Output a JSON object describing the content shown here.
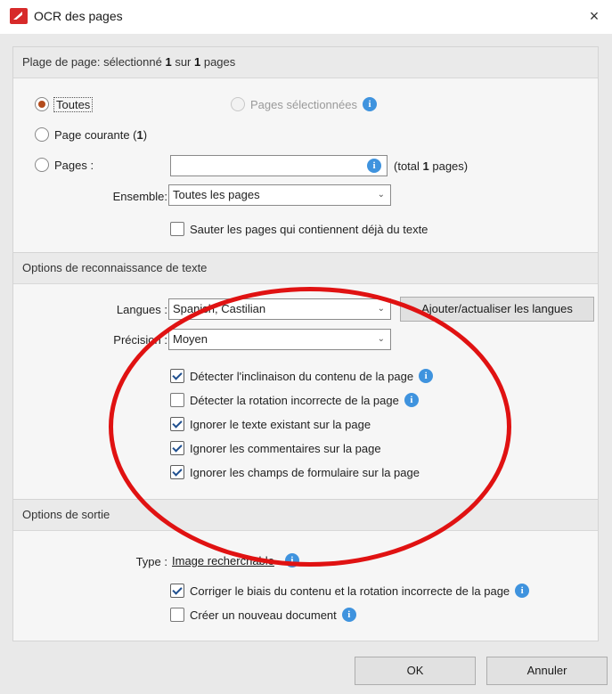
{
  "window": {
    "title": "OCR des pages",
    "close_label": "×"
  },
  "page_range": {
    "header_prefix": "Plage de page: sélectionné ",
    "selected": "1",
    "header_mid": " sur ",
    "total": "1",
    "header_suffix": " pages",
    "all_label": "Toutes",
    "selected_pages_label": "Pages sélectionnées",
    "current_page_label_prefix": "Page courante (",
    "current_page_number": "1",
    "current_page_label_suffix": ")",
    "pages_label": "Pages :",
    "pages_value": "",
    "total_prefix": "(total ",
    "total_number": "1",
    "total_suffix": " pages)",
    "ensemble_label": "Ensemble:",
    "ensemble_value": "Toutes les pages",
    "skip_text_label": "Sauter les pages qui contiennent déjà du texte"
  },
  "recognition": {
    "header": "Options de reconnaissance de texte",
    "languages_label": "Langues :",
    "languages_value": "Spanish; Castilian",
    "add_languages_button": "Ajouter/actualiser les langues",
    "precision_label": "Précision :",
    "precision_value": "Moyen",
    "options": [
      {
        "label": "Détecter l'inclinaison du contenu de la page",
        "checked": true,
        "info": true
      },
      {
        "label": "Détecter la rotation incorrecte de la page",
        "checked": false,
        "info": true
      },
      {
        "label": "Ignorer le texte existant sur la page",
        "checked": true,
        "info": false
      },
      {
        "label": "Ignorer les commentaires sur la page",
        "checked": true,
        "info": false
      },
      {
        "label": "Ignorer les champs de formulaire sur la page",
        "checked": true,
        "info": false
      }
    ]
  },
  "output": {
    "header": "Options de sortie",
    "type_label": "Type :",
    "type_value": "Image recherchable",
    "correct_label": "Corriger le biais du contenu et la rotation incorrecte de la page",
    "new_document_label": "Créer un nouveau document"
  },
  "footer": {
    "ok_label": "OK",
    "cancel_label": "Annuler"
  },
  "colors": {
    "annotation": "#e01212",
    "info": "#3f93de",
    "radio_checked": "#b34b1c"
  },
  "icons": {
    "info": "info-icon",
    "close": "close-icon",
    "app": "pdf-app-icon",
    "dropdown": "chevron-down-icon"
  },
  "glyphs": {
    "info": "i",
    "dropdown": "⌄"
  }
}
